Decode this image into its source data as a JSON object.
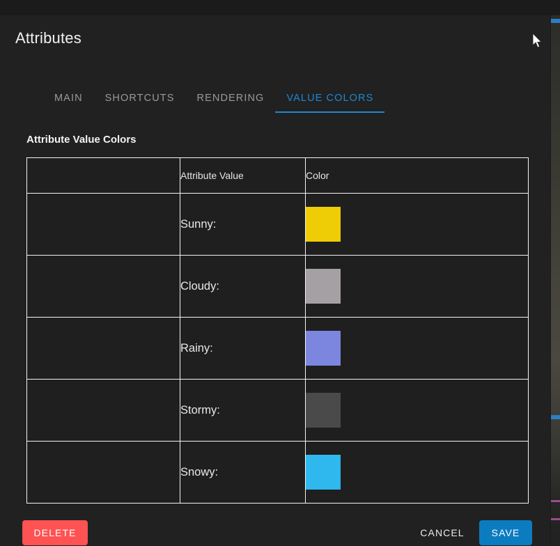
{
  "window": {
    "title": "Attributes"
  },
  "tabs": [
    {
      "label": "MAIN",
      "active": false
    },
    {
      "label": "SHORTCUTS",
      "active": false
    },
    {
      "label": "RENDERING",
      "active": false
    },
    {
      "label": "VALUE COLORS",
      "active": true
    }
  ],
  "section": {
    "title": "Attribute Value Colors"
  },
  "table": {
    "headers": {
      "spacer": "",
      "attribute_value": "Attribute Value",
      "color": "Color"
    },
    "rows": [
      {
        "label": "Sunny:",
        "color": "#efcd06"
      },
      {
        "label": "Cloudy:",
        "color": "#a5a0a3"
      },
      {
        "label": "Rainy:",
        "color": "#7d86df"
      },
      {
        "label": "Stormy:",
        "color": "#4a4a4a"
      },
      {
        "label": "Snowy:",
        "color": "#2eb8ed"
      }
    ]
  },
  "footer": {
    "delete_label": "DELETE",
    "cancel_label": "CANCEL",
    "save_label": "SAVE"
  },
  "colors": {
    "accent_blue": "#1e88d2",
    "save_blue": "#0c7cc0",
    "delete_red": "#ff5252",
    "dialog_bg": "#212121",
    "table_border": "#f5f5f5"
  },
  "cursor": {
    "icon": "mouse-pointer"
  }
}
